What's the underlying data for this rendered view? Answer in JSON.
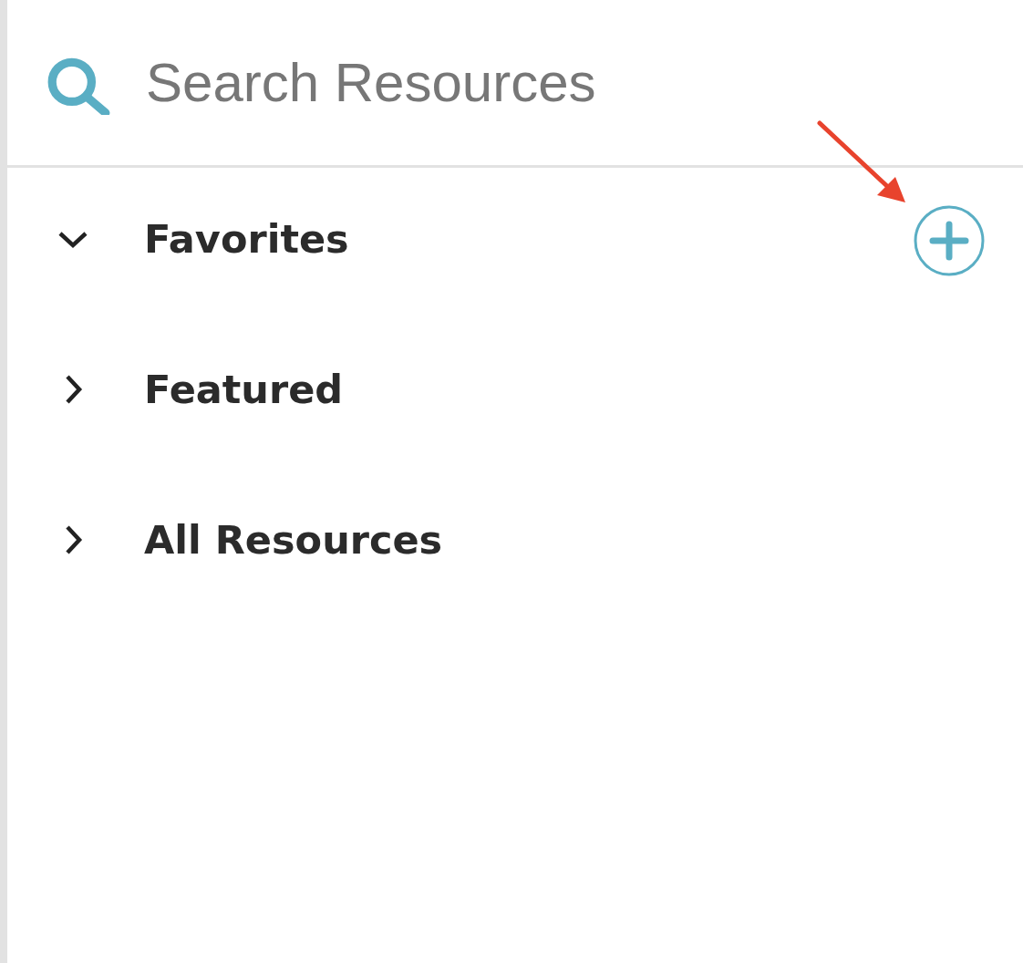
{
  "search": {
    "placeholder": "Search Resources"
  },
  "sections": [
    {
      "label": "Favorites",
      "expanded": true,
      "addable": true
    },
    {
      "label": "Featured",
      "expanded": false,
      "addable": false
    },
    {
      "label": "All Resources",
      "expanded": false,
      "addable": false
    }
  ]
}
